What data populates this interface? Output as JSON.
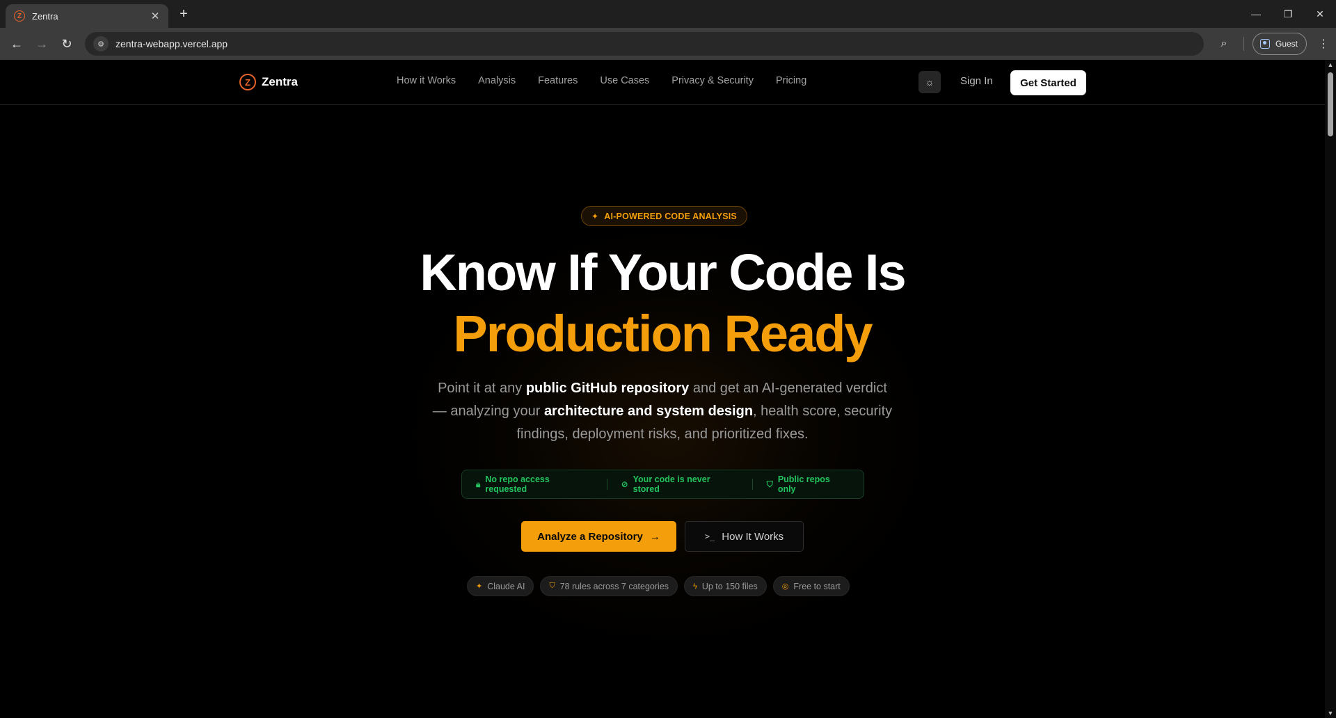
{
  "browser": {
    "tab_title": "Zentra",
    "tab_favicon": "Z",
    "url": "zentra-webapp.vercel.app",
    "profile_label": "Guest",
    "icons": [
      "close-icon",
      "plus-icon",
      "back-icon",
      "forward-icon",
      "reload-icon",
      "site-info-icon",
      "lens-icon",
      "profile-icon",
      "menu-dots-icon",
      "minimize-icon",
      "maximize-icon",
      "window-close-icon"
    ]
  },
  "nav": {
    "brand_mark": "Z",
    "brand": "Zentra",
    "links": [
      "How it Works",
      "Analysis",
      "Features",
      "Use Cases",
      "Privacy & Security",
      "Pricing"
    ],
    "sign_in": "Sign In",
    "get_started": "Get Started"
  },
  "hero": {
    "badge": "AI-POWERED CODE ANALYSIS",
    "title_line1": "Know If Your Code Is",
    "title_line2": "Production Ready",
    "subtitle": {
      "p1": "Point it at any ",
      "b1": "public GitHub repository",
      "p2": " and get an AI-generated verdict — analyzing your ",
      "b2": "architecture and system design",
      "p3": ", health score, security findings, deployment risks, and prioritized fixes."
    },
    "trust": [
      "No repo access requested",
      "Your code is never stored",
      "Public repos only"
    ],
    "cta_primary": "Analyze a Repository",
    "cta_secondary": "How It Works",
    "chips": [
      "Claude AI",
      "78 rules across 7 categories",
      "Up to 150 files",
      "Free to start"
    ]
  },
  "colors": {
    "accent": "#f59e0b",
    "logo": "#e8632b",
    "success": "#22c55e",
    "background": "#000000"
  }
}
